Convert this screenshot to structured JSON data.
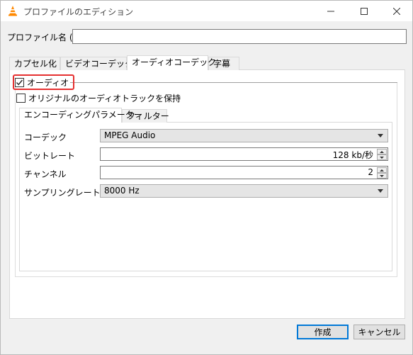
{
  "window": {
    "title": "プロファイルのエディション",
    "icon": "vlc-cone-icon"
  },
  "profile": {
    "name_label": "プロファイル名 (N)",
    "name_value": ""
  },
  "tabs": [
    {
      "label": "カプセル化"
    },
    {
      "label": "ビデオコーデック"
    },
    {
      "label": "オーディオコーデック",
      "active": true
    },
    {
      "label": "字幕"
    }
  ],
  "audio": {
    "enable_label": "オーディオ",
    "enabled": true,
    "keep_original_label": "オリジナルのオーディオトラックを保持",
    "keep_original": false
  },
  "subtabs": [
    {
      "label": "エンコーディングパラメーター",
      "active": true
    },
    {
      "label": "フィルター"
    }
  ],
  "params": {
    "codec_label": "コーデック",
    "codec_value": "MPEG Audio",
    "bitrate_label": "ビットレート",
    "bitrate_value": "128 kb/秒",
    "channels_label": "チャンネル",
    "channels_value": "2",
    "samplerate_label": "サンプリングレート (m)",
    "samplerate_value": "8000 Hz"
  },
  "buttons": {
    "create": "作成",
    "cancel": "キャンセル"
  },
  "colors": {
    "highlight": "#e53030",
    "primary_border": "#0078d7"
  }
}
